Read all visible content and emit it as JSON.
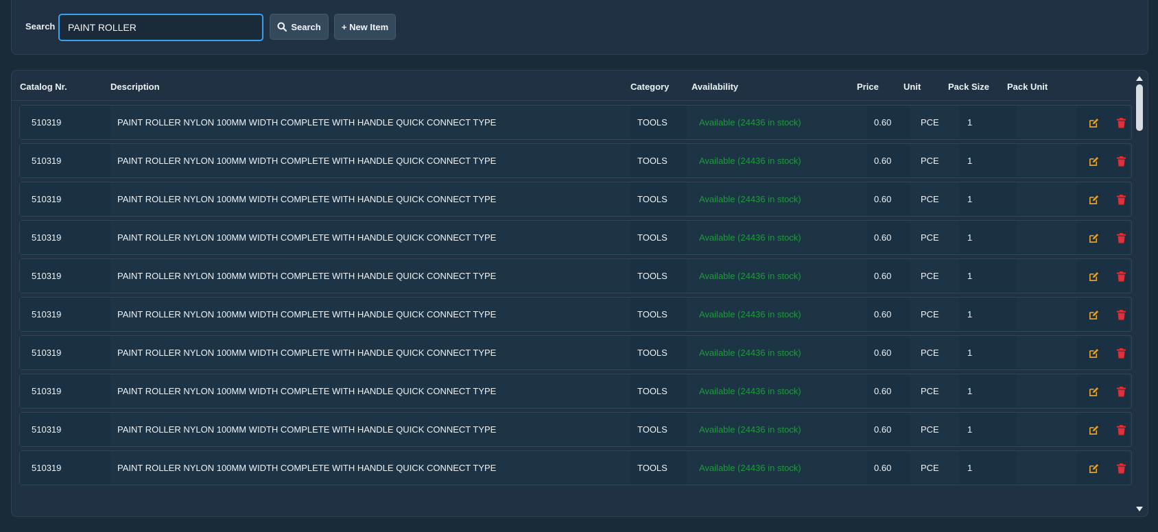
{
  "search": {
    "label": "Search",
    "value": "PAINT ROLLER",
    "search_button": "Search",
    "new_item_button": "+ New Item"
  },
  "table": {
    "columns": [
      "Catalog Nr.",
      "Description",
      "Category",
      "Availability",
      "Price",
      "Unit",
      "Pack Size",
      "Pack Unit"
    ],
    "rows": [
      {
        "catalog": "510319",
        "description": "PAINT ROLLER NYLON 100MM WIDTH COMPLETE WITH HANDLE QUICK CONNECT TYPE",
        "category": "TOOLS",
        "availability": "Available (24436 in stock)",
        "price": "0.60",
        "unit": "PCE",
        "pack_size": "1",
        "pack_unit": ""
      },
      {
        "catalog": "510319",
        "description": "PAINT ROLLER NYLON 100MM WIDTH COMPLETE WITH HANDLE QUICK CONNECT TYPE",
        "category": "TOOLS",
        "availability": "Available (24436 in stock)",
        "price": "0.60",
        "unit": "PCE",
        "pack_size": "1",
        "pack_unit": ""
      },
      {
        "catalog": "510319",
        "description": "PAINT ROLLER NYLON 100MM WIDTH COMPLETE WITH HANDLE QUICK CONNECT TYPE",
        "category": "TOOLS",
        "availability": "Available (24436 in stock)",
        "price": "0.60",
        "unit": "PCE",
        "pack_size": "1",
        "pack_unit": ""
      },
      {
        "catalog": "510319",
        "description": "PAINT ROLLER NYLON 100MM WIDTH COMPLETE WITH HANDLE QUICK CONNECT TYPE",
        "category": "TOOLS",
        "availability": "Available (24436 in stock)",
        "price": "0.60",
        "unit": "PCE",
        "pack_size": "1",
        "pack_unit": ""
      },
      {
        "catalog": "510319",
        "description": "PAINT ROLLER NYLON 100MM WIDTH COMPLETE WITH HANDLE QUICK CONNECT TYPE",
        "category": "TOOLS",
        "availability": "Available (24436 in stock)",
        "price": "0.60",
        "unit": "PCE",
        "pack_size": "1",
        "pack_unit": ""
      },
      {
        "catalog": "510319",
        "description": "PAINT ROLLER NYLON 100MM WIDTH COMPLETE WITH HANDLE QUICK CONNECT TYPE",
        "category": "TOOLS",
        "availability": "Available (24436 in stock)",
        "price": "0.60",
        "unit": "PCE",
        "pack_size": "1",
        "pack_unit": ""
      },
      {
        "catalog": "510319",
        "description": "PAINT ROLLER NYLON 100MM WIDTH COMPLETE WITH HANDLE QUICK CONNECT TYPE",
        "category": "TOOLS",
        "availability": "Available (24436 in stock)",
        "price": "0.60",
        "unit": "PCE",
        "pack_size": "1",
        "pack_unit": ""
      },
      {
        "catalog": "510319",
        "description": "PAINT ROLLER NYLON 100MM WIDTH COMPLETE WITH HANDLE QUICK CONNECT TYPE",
        "category": "TOOLS",
        "availability": "Available (24436 in stock)",
        "price": "0.60",
        "unit": "PCE",
        "pack_size": "1",
        "pack_unit": ""
      },
      {
        "catalog": "510319",
        "description": "PAINT ROLLER NYLON 100MM WIDTH COMPLETE WITH HANDLE QUICK CONNECT TYPE",
        "category": "TOOLS",
        "availability": "Available (24436 in stock)",
        "price": "0.60",
        "unit": "PCE",
        "pack_size": "1",
        "pack_unit": ""
      },
      {
        "catalog": "510319",
        "description": "PAINT ROLLER NYLON 100MM WIDTH COMPLETE WITH HANDLE QUICK CONNECT TYPE",
        "category": "TOOLS",
        "availability": "Available (24436 in stock)",
        "price": "0.60",
        "unit": "PCE",
        "pack_size": "1",
        "pack_unit": ""
      }
    ]
  },
  "icons": {
    "search": "search-icon",
    "edit": "edit-icon",
    "delete": "trash-icon"
  },
  "colors": {
    "accent": "#3aa0f0",
    "available": "#1e9a3a",
    "edit": "#f0a020",
    "delete": "#e0303a"
  }
}
